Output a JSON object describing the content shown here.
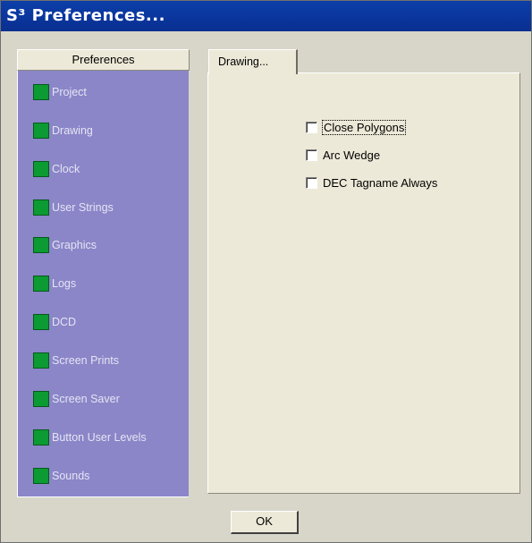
{
  "window": {
    "title": "S³ Preferences..."
  },
  "sidebar": {
    "header": "Preferences",
    "items": [
      {
        "label": "Project"
      },
      {
        "label": "Drawing"
      },
      {
        "label": "Clock"
      },
      {
        "label": "User Strings"
      },
      {
        "label": "Graphics"
      },
      {
        "label": "Logs"
      },
      {
        "label": "DCD"
      },
      {
        "label": "Screen Prints"
      },
      {
        "label": "Screen Saver"
      },
      {
        "label": "Button User Levels"
      },
      {
        "label": "Sounds"
      }
    ]
  },
  "tab": {
    "label": "Drawing..."
  },
  "options": [
    {
      "label": "Close Polygons",
      "checked": false
    },
    {
      "label": "Arc Wedge",
      "checked": false
    },
    {
      "label": "DEC Tagname Always",
      "checked": false
    }
  ],
  "ok_button": {
    "label": "OK"
  },
  "colors": {
    "titlebar": "#0a37a0",
    "sidebar": "#8a86c8",
    "item_indicator": "#0c9a32",
    "dialog_face": "#ece9d8"
  }
}
